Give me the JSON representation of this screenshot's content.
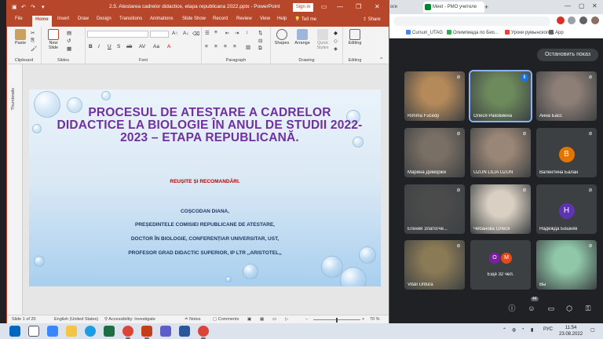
{
  "chrome": {
    "tabs": [
      "оги",
      "Meet - РМО учителе",
      "+"
    ],
    "bookmarks": [
      "Cursuri_UTAG",
      "Олимпиада по Био...",
      "Уроки румынского...",
      "App"
    ],
    "stop_presenting": "Остановить показ"
  },
  "participants": [
    {
      "name": "Rimma Fucedji",
      "kind": "photo",
      "color": "#b58a5a",
      "muted": true
    },
    {
      "name": "Олеся Раковиена",
      "kind": "photo",
      "color": "#6d8a5c",
      "muted": false,
      "active": true
    },
    {
      "name": "Анна Басс",
      "kind": "photo",
      "color": "#8d7f76",
      "muted": true
    },
    {
      "name": "Марина Деморжи",
      "kind": "photo",
      "color": "#7a6f64",
      "muted": true
    },
    {
      "name": "UZUN LILIA UZUN",
      "kind": "photo",
      "color": "#9a8676",
      "muted": true
    },
    {
      "name": "Валентина Балан",
      "kind": "avatar",
      "initial": "B",
      "avatar_color": "#e37400",
      "muted": true
    },
    {
      "name": "Егения Златогче...",
      "kind": "photo",
      "color": "#4b4b4b",
      "muted": true
    },
    {
      "name": "Чебанова Олеся",
      "kind": "photo",
      "color": "#d9cfc2",
      "muted": true
    },
    {
      "name": "Надежда Бошняк",
      "kind": "avatar",
      "initial": "H",
      "avatar_color": "#5e35b1",
      "muted": true
    },
    {
      "name": "Vitali Untura",
      "kind": "photo",
      "color": "#8a7a55",
      "muted": true
    },
    {
      "name": "Ещё 32 чел.",
      "kind": "more",
      "muted": false
    },
    {
      "name": "Вы",
      "kind": "photo",
      "color": "#8fc7a8",
      "muted": true
    }
  ],
  "more_avatars": [
    {
      "initial": "O",
      "color": "#7b1fa2"
    },
    {
      "initial": "M",
      "color": "#e64a19"
    }
  ],
  "meet_controls": {
    "participants_count": "44"
  },
  "ppt": {
    "title": "2.5. Atestarea cadrelor didactice, etapa republicana 2022.pptx - PowerPoint",
    "sign_in": "Sign in",
    "tell_me": "Tell me",
    "share": "Share",
    "tabs": [
      "File",
      "Home",
      "Insert",
      "Draw",
      "Design",
      "Transitions",
      "Animations",
      "Slide Show",
      "Record",
      "Review",
      "View",
      "Help"
    ],
    "groups": {
      "clipboard": "Clipboard",
      "slides": "Slides",
      "font": "Font",
      "paragraph": "Paragraph",
      "drawing": "Drawing",
      "editing": "Editing"
    },
    "buttons": {
      "paste": "Paste",
      "new_slide": "New Slide",
      "shapes": "Shapes",
      "arrange": "Arrange",
      "quick_styles": "Quick Styles",
      "editing": "Editing"
    },
    "font_buttons": [
      "B",
      "I",
      "U",
      "S",
      "ab",
      "AV",
      "Aa",
      "A"
    ],
    "thumbnails_label": "Thumbnails",
    "status": {
      "slide": "Slide 1 of 20",
      "language": "English (United States)",
      "accessibility": "Accessibility: Investigate",
      "notes": "Notes",
      "comments": "Comments",
      "zoom": "70 %"
    }
  },
  "slide": {
    "title": "PROCESUL DE ATESTARE A CADRELOR DIDACTICE LA BIOLOGIE ÎN ANUL DE STUDII 2022-2023 – ETAPA REPUBLICANĂ.",
    "subtitle": "REUȘITE ȘI RECOMANDĂRI.",
    "lines": [
      "COȘCODAN DIANA,",
      "PREȘEDINTELE COMISIEI REPUBLICANE DE ATESTARE,",
      "DOCTOR ÎN BIOLOGIE, CONFERENȚIAR UNIVERSITAR, UST,",
      "PROFESOR GRAD DIDACTIC SUPERIOR, IP LTR ,,ARISTOTEL,,"
    ]
  },
  "taskbar": {
    "apps": [
      "start-icon",
      "search-icon",
      "widgets-icon",
      "file-explorer-icon",
      "edge-icon",
      "excel-icon",
      "chrome-icon",
      "powerpoint-icon",
      "teams-icon",
      "word-icon",
      "chrome-icon"
    ],
    "language": "РУС",
    "time": "11:54",
    "date": "23.08.2022"
  }
}
